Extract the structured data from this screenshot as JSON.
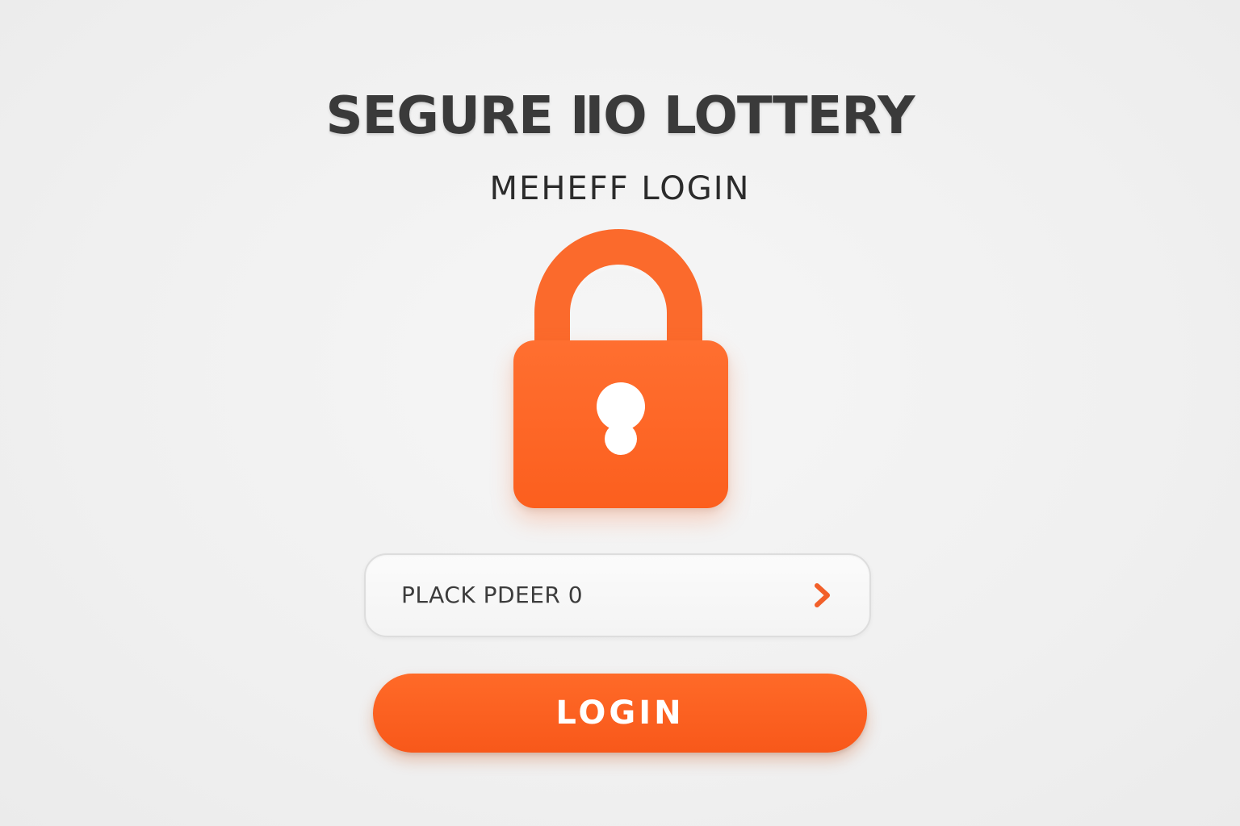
{
  "header": {
    "title": "SEGURE ⅡO LOTTERY",
    "subtitle": "MEHEFF LOGIN"
  },
  "lock": {
    "icon": "padlock-icon",
    "color": "#fb6a2c",
    "keyhole_color": "#ffffff"
  },
  "input": {
    "placeholder": "PLACK PDEER 0",
    "submit_icon": "chevron-right-icon",
    "accent": "#f2602a"
  },
  "login_button": {
    "label": "LOGIN",
    "color": "#fb6a2c"
  }
}
